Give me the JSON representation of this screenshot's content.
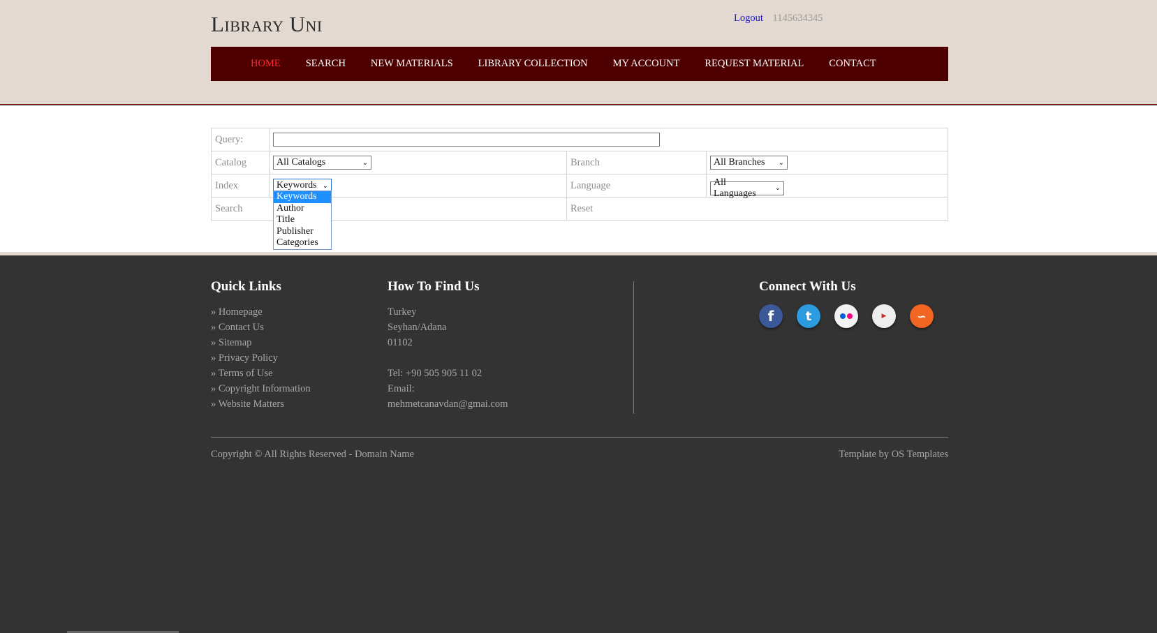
{
  "header": {
    "logo": "Library Uni",
    "logout": "Logout",
    "user_id": "1145634345"
  },
  "nav": {
    "items": [
      {
        "label": "HOME",
        "active": true
      },
      {
        "label": "SEARCH"
      },
      {
        "label": "NEW MATERIALS"
      },
      {
        "label": "LIBRARY COLLECTION"
      },
      {
        "label": "MY ACCOUNT"
      },
      {
        "label": "REQUEST MATERIAL"
      },
      {
        "label": "CONTACT"
      }
    ]
  },
  "form": {
    "query_label": "Query:",
    "query_value": "",
    "catalog_label": "Catalog",
    "catalog_selected": "All Catalogs",
    "branch_label": "Branch",
    "branch_selected": "All Branches",
    "index_label": "Index",
    "index_selected": "Keywords",
    "language_label": "Language",
    "language_selected": "All Languages",
    "search_label": "Search",
    "reset_label": "Reset",
    "index_options": [
      "Keywords",
      "Author",
      "Title",
      "Publisher",
      "Categories"
    ]
  },
  "footer": {
    "quick_links_title": "Quick Links",
    "quick_links": [
      "» Homepage",
      "» Contact Us",
      "» Sitemap",
      "» Privacy Policy",
      "» Terms of Use",
      "» Copyright Information",
      "» Website Matters"
    ],
    "find_us_title": "How To Find Us",
    "address": [
      "Turkey",
      "Seyhan/Adana",
      "01102"
    ],
    "tel": "Tel: +90 505 905 11 02",
    "email_label": "Email:",
    "email": "mehmetcanavdan@gmai.com",
    "connect_title": "Connect With Us",
    "social_icons": [
      "facebook-icon",
      "twitter-icon",
      "flickr-icon",
      "youtube-icon",
      "rss-icon"
    ],
    "copyright": "Copyright © All Rights Reserved - Domain Name",
    "credit": "Template by OS Templates"
  },
  "colors": {
    "header_bg": "#e3d9d0",
    "nav_bg": "#4e0000",
    "nav_active": "#ff2a2a",
    "footer_bg": "#333333",
    "dropdown_highlight": "#1e90ff"
  }
}
